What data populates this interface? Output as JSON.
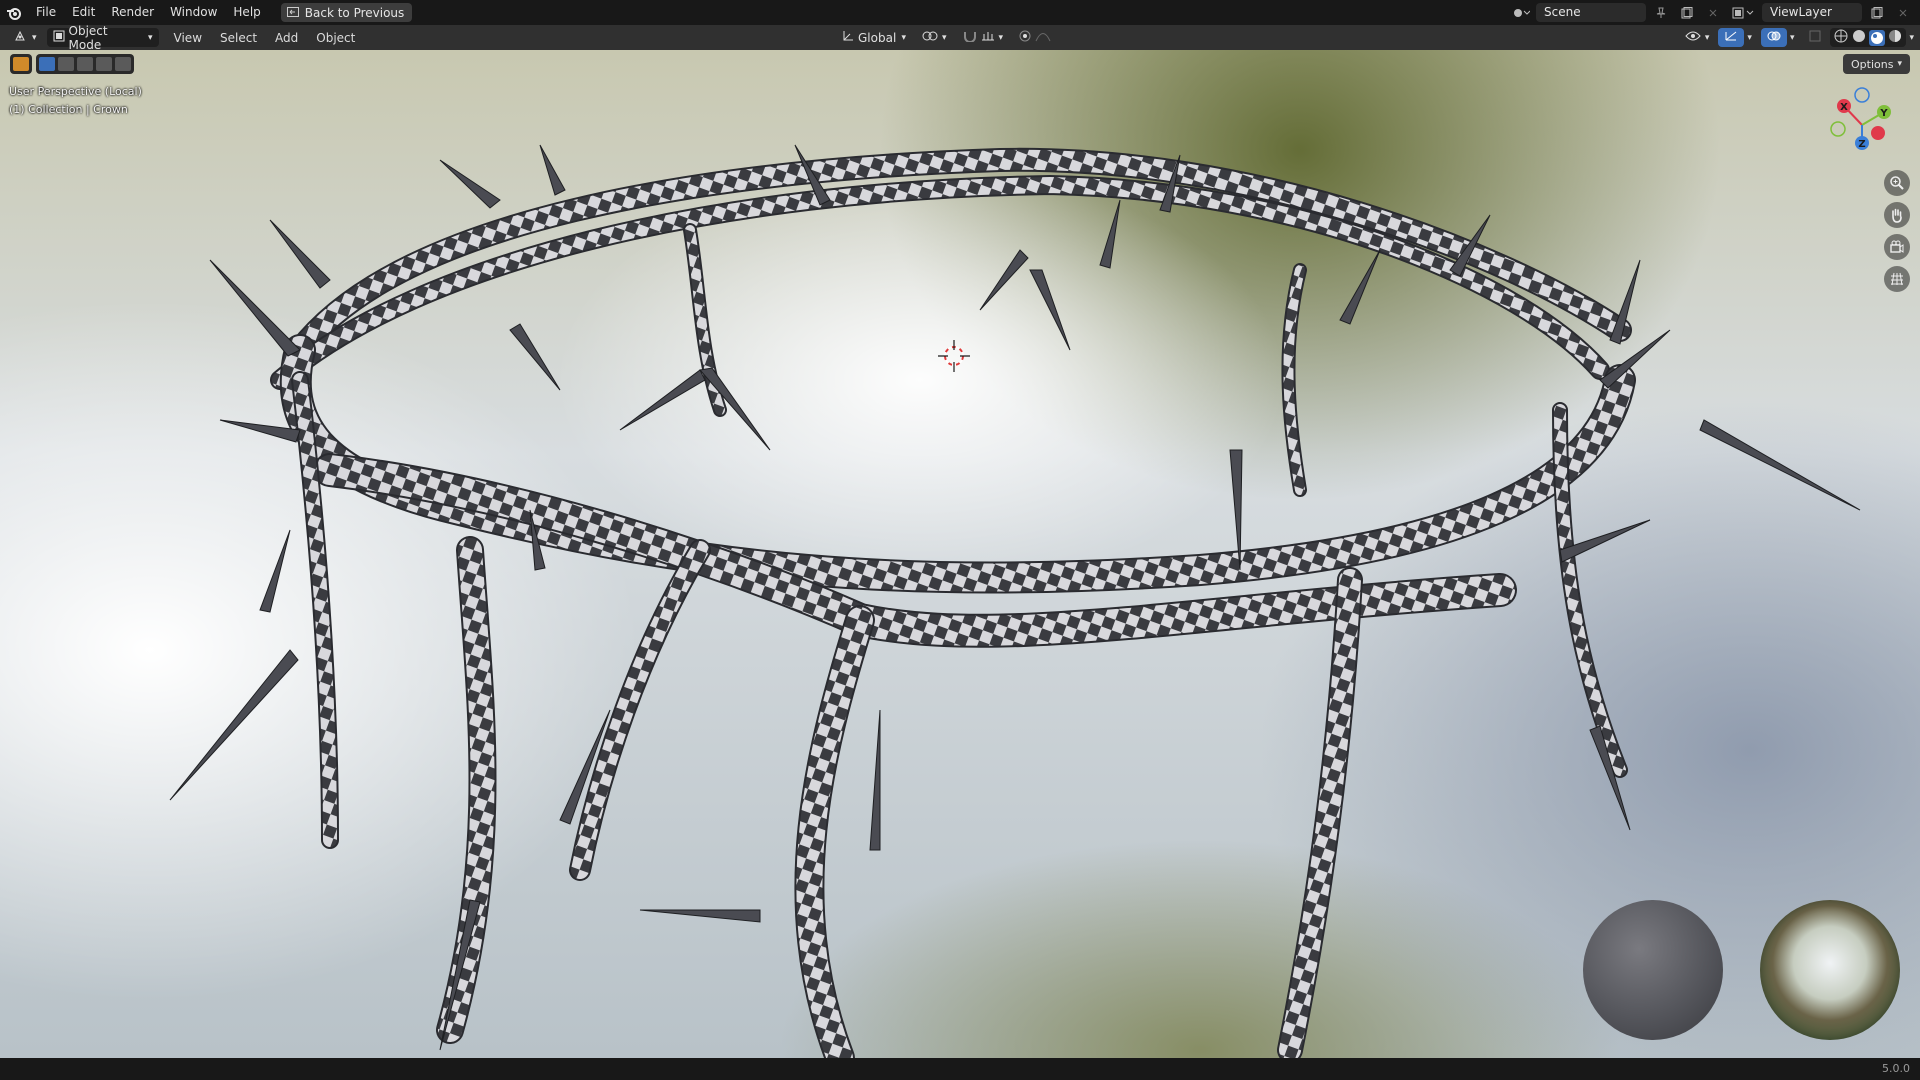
{
  "topbar": {
    "menus": [
      "File",
      "Edit",
      "Render",
      "Window",
      "Help"
    ],
    "back_label": "Back to Previous",
    "scene_value": "Scene",
    "viewlayer_value": "ViewLayer"
  },
  "header": {
    "mode_label": "Object Mode",
    "menus": [
      "View",
      "Select",
      "Add",
      "Object"
    ],
    "orientation_label": "Global",
    "options_label": "Options"
  },
  "viewport": {
    "perspective_label": "User Perspective (Local)",
    "collection_label": "(1) Collection | Crown",
    "gizmo_axes": [
      "X",
      "Y",
      "Z"
    ],
    "accent_colors": {
      "x_axis": "#e0394b",
      "y_axis": "#7fbf3a",
      "z_axis": "#3a7fd8",
      "active": "#3b6fb8"
    }
  },
  "statusbar": {
    "version": "5.0.0"
  },
  "icons": [
    "blender-logo-icon",
    "back-icon",
    "zoom-icon",
    "pan-hand-icon",
    "camera-icon",
    "grid-icon",
    "pin-icon",
    "new-scene-icon",
    "close-icon"
  ]
}
